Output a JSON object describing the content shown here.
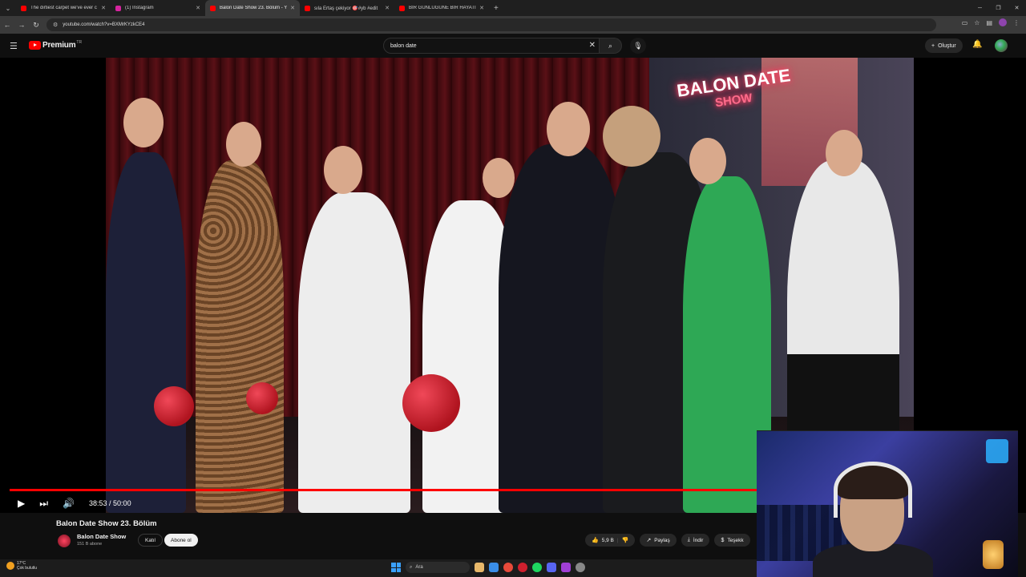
{
  "browser": {
    "tabs": [
      {
        "title": "The dirtiest carpet we've ever c",
        "favicon_color": "#ff0000",
        "active": false
      },
      {
        "title": "(1) Instagram",
        "favicon_color": "#d6249f",
        "active": false
      },
      {
        "title": "Balon Date Show 23. Bölüm - Y",
        "favicon_color": "#ff0000",
        "active": true
      },
      {
        "title": "sıla Ertaş çekiyor 🎯#yb #edit",
        "favicon_color": "#ff0000",
        "active": false
      },
      {
        "title": "BİR GÜNLÜĞÜNE BİR HAYATI D",
        "favicon_color": "#ff0000",
        "active": false
      }
    ],
    "new_tab_glyph": "+",
    "url": "youtube.com/watch?v=BXMrKYzkCE4"
  },
  "header": {
    "logo_text": "Premium",
    "logo_country": "TR",
    "search_value": "balon date",
    "create_label": "Oluştur"
  },
  "player": {
    "current_time": "38:53",
    "separator": " / ",
    "duration": "50:00",
    "progress_fraction": 0.7777
  },
  "video": {
    "title": "Balon Date Show 23. Bölüm",
    "channel_name": "Balon Date Show",
    "subscribers": "151 B abone",
    "join_label": "Katıl",
    "subscribe_label": "Abone ol",
    "like_count": "5,9 B",
    "share_label": "Paylaş",
    "download_label": "İndir",
    "thanks_label": "Teşekk"
  },
  "scene": {
    "neon_line1": "BALON DATE",
    "neon_line2": "SHOW"
  },
  "taskbar": {
    "temperature": "17°C",
    "weather_text": "Çok bulutlu",
    "search_label": "Ara"
  },
  "colors": {
    "accent": "#ff0000",
    "background": "#0f0f0f"
  }
}
